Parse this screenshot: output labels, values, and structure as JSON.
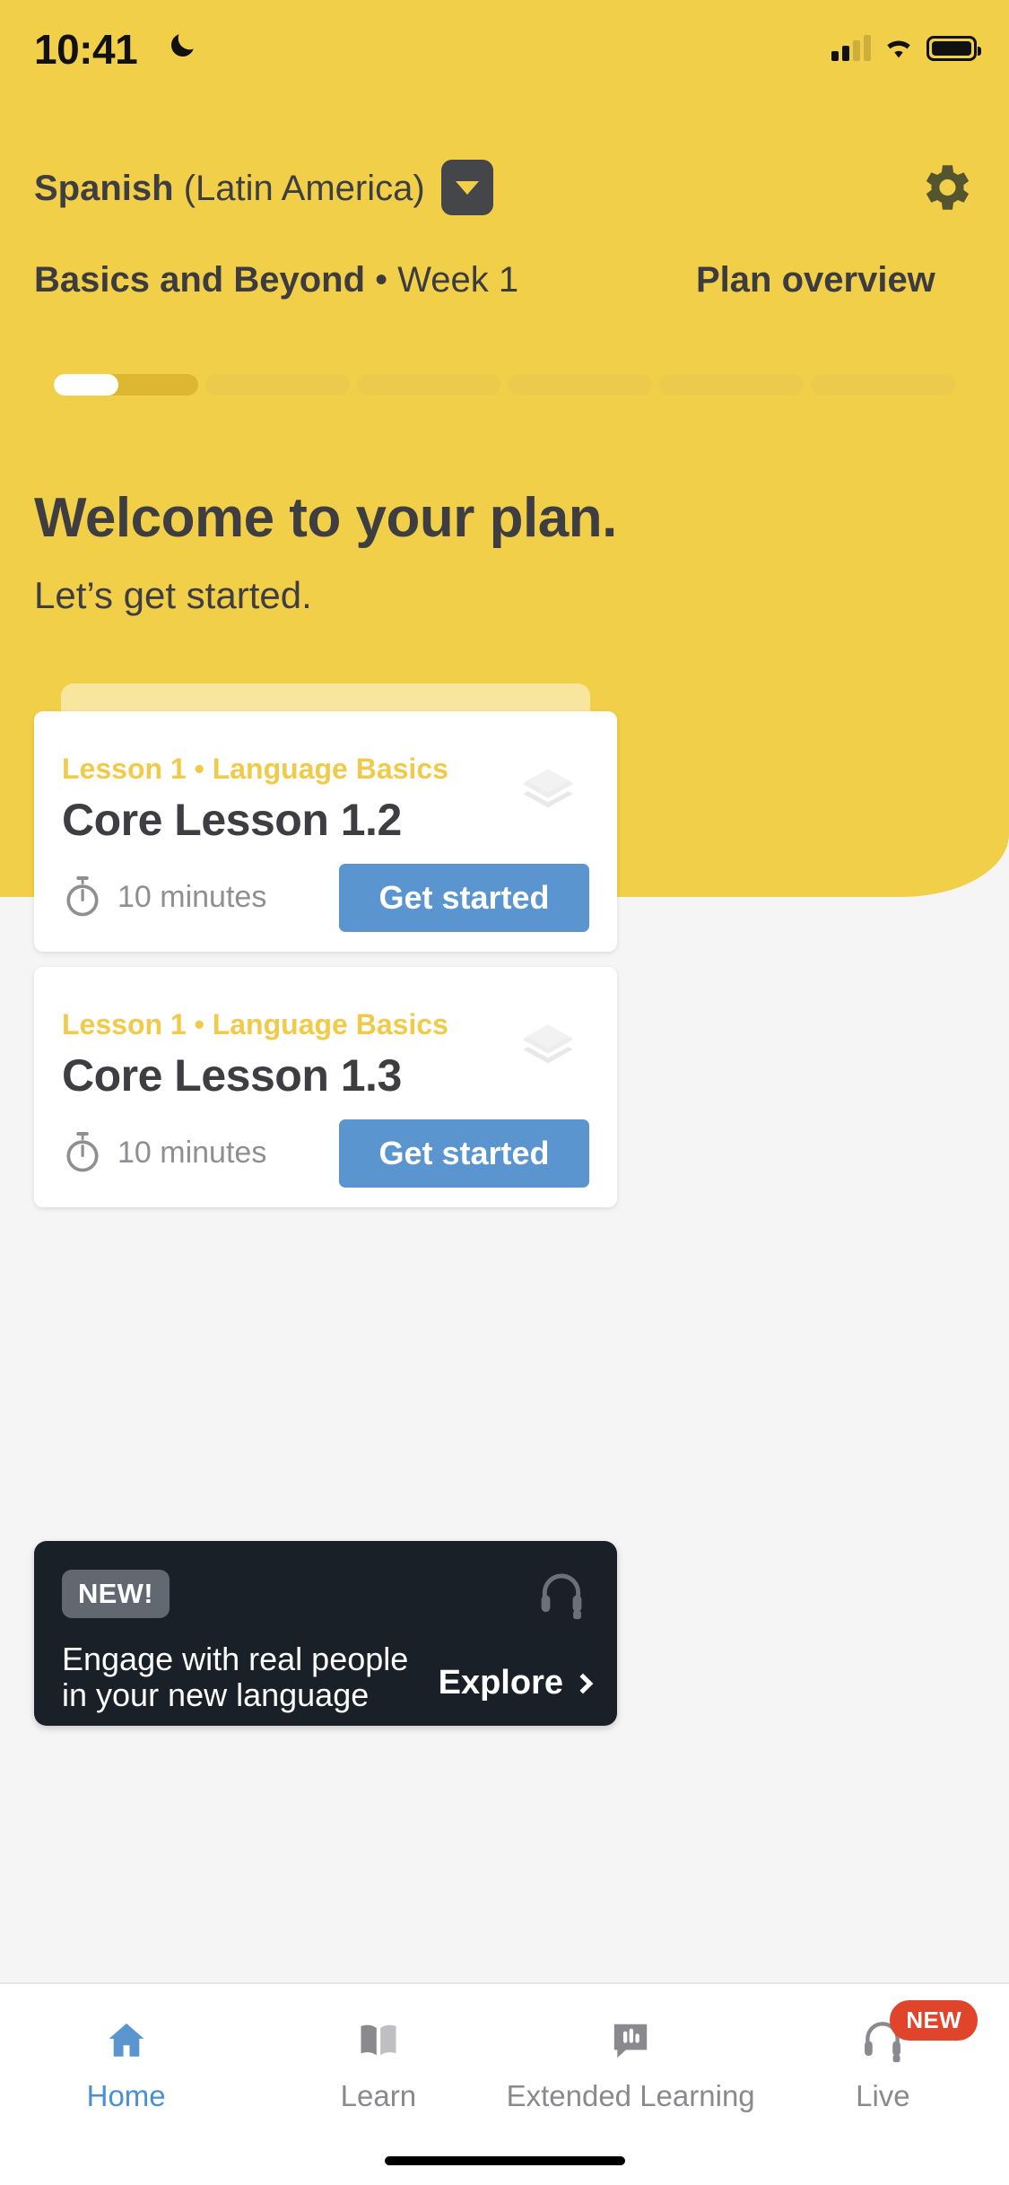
{
  "status_bar": {
    "time": "10:41",
    "moon_icon": "crescent-moon-icon",
    "signal_icon": "cellular-signal-icon",
    "wifi_icon": "wifi-icon",
    "battery_icon": "battery-icon"
  },
  "header": {
    "language_name": "Spanish",
    "language_region": "(Latin America)",
    "dropdown_icon": "chevron-down-icon",
    "settings_icon": "gear-icon",
    "plan_name": "Basics and Beyond",
    "plan_week": " • Week 1",
    "plan_overview_label": "Plan overview",
    "progress": {
      "segments": 6,
      "active_segment": 1,
      "active_fill_percent": 45
    }
  },
  "welcome": {
    "title": "Welcome to your plan.",
    "subtitle": "Let’s get started."
  },
  "lessons": [
    {
      "eyebrow": "Lesson 1  •  Language Basics",
      "title": "Core Lesson 1.2",
      "duration": "10 minutes",
      "cta_label": "Get started",
      "stack_icon": "layers-icon",
      "timer_icon": "stopwatch-icon"
    },
    {
      "eyebrow": "Lesson 1  •  Language Basics",
      "title": "Core Lesson 1.3",
      "duration": "10 minutes",
      "cta_label": "Get started",
      "stack_icon": "layers-icon",
      "timer_icon": "stopwatch-icon"
    }
  ],
  "promo": {
    "badge": "NEW!",
    "headline": "Engage with real people in your new language",
    "cta_label": "Explore",
    "cta_icon": "chevron-right-icon",
    "icon": "headset-icon"
  },
  "tabbar": {
    "items": [
      {
        "label": "Home",
        "icon": "home-icon",
        "active": true,
        "badge": ""
      },
      {
        "label": "Learn",
        "icon": "book-icon",
        "active": false,
        "badge": ""
      },
      {
        "label": "Extended Learning",
        "icon": "chat-bars-icon",
        "active": false,
        "badge": ""
      },
      {
        "label": "Live",
        "icon": "headset-icon",
        "active": false,
        "badge": "NEW"
      }
    ]
  },
  "colors": {
    "brand_yellow": "#f2cf49",
    "accent_blue": "#5b95d0",
    "promo_dark": "#192028",
    "badge_red": "#e0452b",
    "eyebrow_gold": "#f0cb4a"
  }
}
